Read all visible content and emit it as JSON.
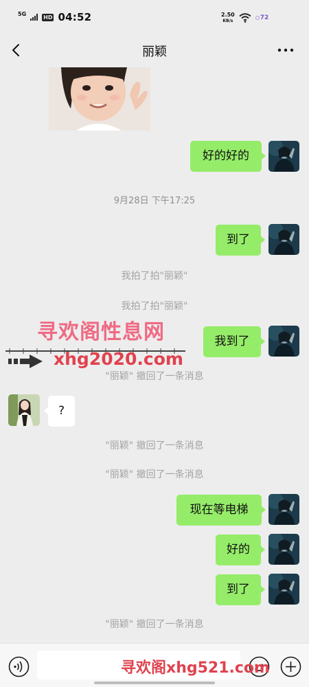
{
  "status_bar": {
    "network": "5G",
    "hd": "HD",
    "time": "04:52",
    "speed_value": "2.50",
    "speed_unit": "KB/s",
    "battery": "72"
  },
  "header": {
    "title": "丽颖"
  },
  "messages": [
    {
      "id": "m1",
      "type": "image",
      "sender": "other"
    },
    {
      "id": "m2",
      "type": "text",
      "sender": "me",
      "text": "好的好的"
    },
    {
      "id": "m3",
      "type": "timestamp",
      "text": "9月28日 下午17:25"
    },
    {
      "id": "m4",
      "type": "text",
      "sender": "me",
      "text": "到了"
    },
    {
      "id": "m5",
      "type": "system",
      "text": "我拍了拍\"丽颖\""
    },
    {
      "id": "m6",
      "type": "system",
      "text": "我拍了拍\"丽颖\""
    },
    {
      "id": "m7",
      "type": "text",
      "sender": "me",
      "text": "我到了"
    },
    {
      "id": "m8",
      "type": "system",
      "text": "\"丽颖\" 撤回了一条消息"
    },
    {
      "id": "m9",
      "type": "text",
      "sender": "other",
      "text": "?"
    },
    {
      "id": "m10",
      "type": "system",
      "text": "\"丽颖\" 撤回了一条消息"
    },
    {
      "id": "m11",
      "type": "system",
      "text": "\"丽颖\" 撤回了一条消息"
    },
    {
      "id": "m12",
      "type": "text",
      "sender": "me",
      "text": "现在等电梯"
    },
    {
      "id": "m13",
      "type": "text",
      "sender": "me",
      "text": "好的"
    },
    {
      "id": "m14",
      "type": "text",
      "sender": "me",
      "text": "到了"
    },
    {
      "id": "m15",
      "type": "system",
      "text": "\"丽颖\" 撤回了一条消息"
    }
  ],
  "watermarks": {
    "site_name": "寻欢阁性息网",
    "url": "xhg2020.com",
    "footer": "寻欢阁xhg521.com"
  },
  "input_bar": {
    "value": "",
    "icons": [
      "voice-icon",
      "emoji-icon",
      "plus-icon"
    ]
  },
  "colors": {
    "background": "#ededed",
    "my_bubble": "#95ec69",
    "other_bubble": "#ffffff",
    "system_text": "#a3a3a3",
    "watermark_pink": "#ef6a84",
    "watermark_red": "#e0424f"
  }
}
